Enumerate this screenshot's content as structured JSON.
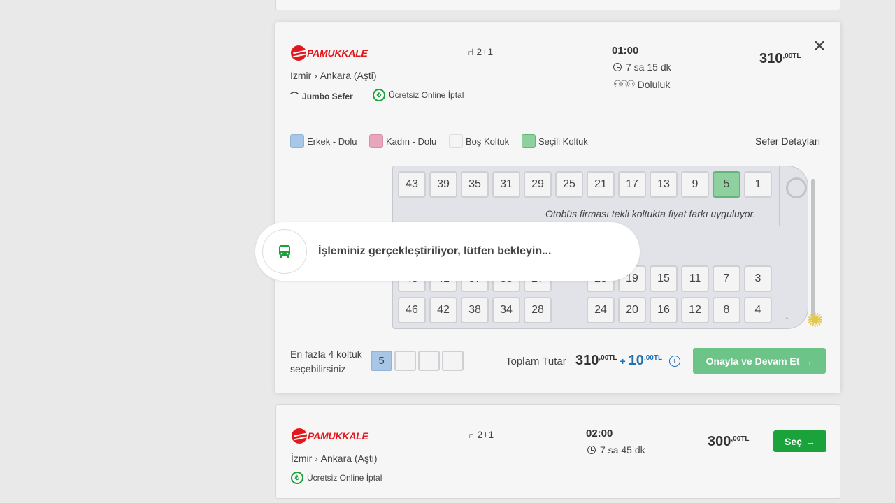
{
  "trip1": {
    "company": "PAMUKKALE",
    "seat_layout": "2+1",
    "route_from": "İzmir",
    "route_to": "Ankara (Aşti)",
    "jumbo": "Jumbo Sefer",
    "cancel": "Ücretsiz Online İptal",
    "time": "01:00",
    "duration": "7 sa 15 dk",
    "occupancy": "Doluluk",
    "price_main": "310",
    "price_sup": ",00TL"
  },
  "legend": {
    "male": "Erkek - Dolu",
    "female": "Kadın - Dolu",
    "empty": "Boş Koltuk",
    "selected": "Seçili Koltuk",
    "details": "Sefer Detayları",
    "colors": {
      "male": "#a8c6e6",
      "female": "#e8a6bb",
      "empty": "#f4f4f4",
      "selected": "#8fd19e"
    }
  },
  "seats": {
    "row1": [
      "43",
      "39",
      "35",
      "31",
      "29",
      "25",
      "21",
      "17",
      "13",
      "9",
      "5",
      "1"
    ],
    "row2": [
      "45",
      "41",
      "37",
      "33",
      "27",
      "23",
      "19",
      "15",
      "11",
      "7",
      "3"
    ],
    "row3": [
      "46",
      "42",
      "38",
      "34",
      "28",
      "24",
      "20",
      "16",
      "12",
      "8",
      "4"
    ],
    "selected": "5"
  },
  "notice": "Otobüs firması tekli koltukta fiyat farkı uyguluyor.",
  "footer": {
    "max_line1": "En fazla 4 koltuk",
    "max_line2": "seçebilirsiniz",
    "chosen_seat": "5",
    "total_label": "Toplam Tutar",
    "total_main": "310",
    "total_sup": ",00TL",
    "plus": "+",
    "fee_main": "10",
    "fee_sup": ",00TL",
    "confirm": "Onayla ve Devam Et"
  },
  "loader": {
    "text": "İşleminiz gerçekleştiriliyor, lütfen bekleyin..."
  },
  "trip2": {
    "company": "PAMUKKALE",
    "seat_layout": "2+1",
    "route_from": "İzmir",
    "route_to": "Ankara (Aşti)",
    "cancel": "Ücretsiz Online İptal",
    "time": "02:00",
    "duration": "7 sa 45 dk",
    "price_main": "300",
    "price_sup": ",00TL",
    "select": "Seç"
  }
}
